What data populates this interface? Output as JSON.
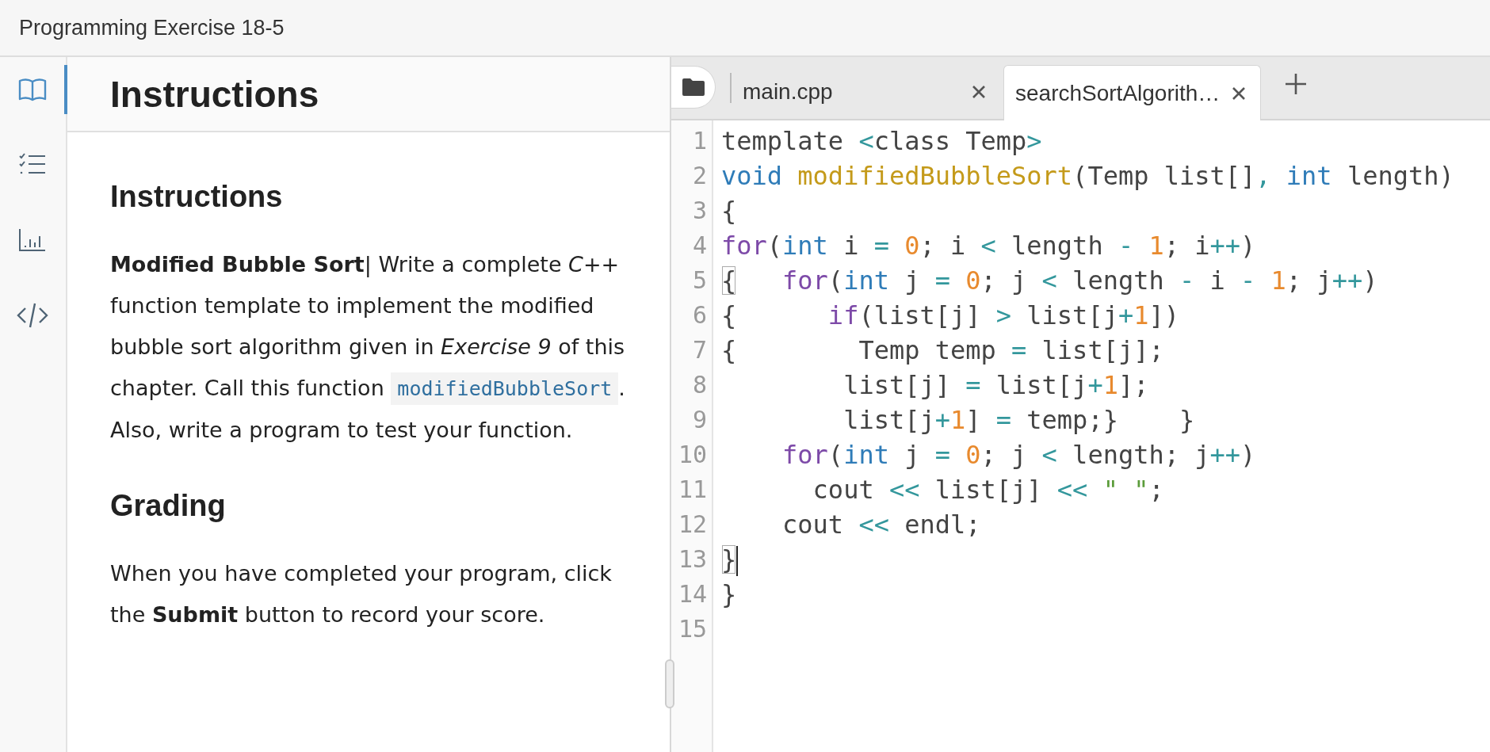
{
  "window": {
    "title": "Programming Exercise 18-5"
  },
  "rail": [
    {
      "kind": "book",
      "selected": true
    },
    {
      "kind": "checklist",
      "selected": false
    },
    {
      "kind": "chart",
      "selected": false
    },
    {
      "kind": "code",
      "selected": false
    }
  ],
  "instructions": {
    "header": "Instructions",
    "heading": "Instructions",
    "paragraph": {
      "before": "**Modified Bubble Sort**| Write a complete *C++* function template to implement the modified bubble sort algorithm given in *Exercise 9* of this chapter. Call this function",
      "code": "modifiedBubbleSort",
      "after": ". Also, write a program to test your function."
    },
    "grading_heading": "Grading",
    "grading": "When you have completed your program, click the **Submit** button to record your score."
  },
  "editor": {
    "tabs": [
      {
        "label": "main.cpp",
        "selected": false
      },
      {
        "label": "searchSortAlgorith…",
        "selected": true
      }
    ],
    "lines": [
      {
        "number": "1",
        "tokens": [
          {
            "kind": "plain",
            "text": "template "
          },
          {
            "kind": "op",
            "text": "<"
          },
          {
            "kind": "plain",
            "text": "class Temp"
          },
          {
            "kind": "op",
            "text": ">"
          }
        ]
      },
      {
        "number": "2",
        "tokens": [
          {
            "kind": "type",
            "text": "void"
          },
          {
            "kind": "fn",
            "text": " modifiedBubbleSort"
          },
          {
            "kind": "plain",
            "text": "(Temp list[]"
          },
          {
            "kind": "op",
            "text": ", "
          },
          {
            "kind": "type",
            "text": "int"
          },
          {
            "kind": "plain",
            "text": " length)"
          }
        ]
      },
      {
        "number": "3",
        "tokens": [
          {
            "kind": "plain",
            "text": "{"
          }
        ]
      },
      {
        "number": "4",
        "tokens": [
          {
            "kind": "keyword",
            "text": "for"
          },
          {
            "kind": "plain",
            "text": "("
          },
          {
            "kind": "type",
            "text": "int"
          },
          {
            "kind": "plain",
            "text": " i "
          },
          {
            "kind": "op",
            "text": "= "
          },
          {
            "kind": "num",
            "text": "0"
          },
          {
            "kind": "plain",
            "text": "; i "
          },
          {
            "kind": "op",
            "text": "<"
          },
          {
            "kind": "plain",
            "text": " length "
          },
          {
            "kind": "op",
            "text": "- "
          },
          {
            "kind": "num",
            "text": "1"
          },
          {
            "kind": "plain",
            "text": "; i"
          },
          {
            "kind": "op",
            "text": "++"
          },
          {
            "kind": "plain",
            "text": ")"
          }
        ]
      },
      {
        "number": "5",
        "tokens": [
          {
            "kind": "match",
            "text": "{"
          },
          {
            "kind": "keyword",
            "text": "   for"
          },
          {
            "kind": "plain",
            "text": "("
          },
          {
            "kind": "type",
            "text": "int"
          },
          {
            "kind": "plain",
            "text": " j "
          },
          {
            "kind": "op",
            "text": "= "
          },
          {
            "kind": "num",
            "text": "0"
          },
          {
            "kind": "plain",
            "text": "; j "
          },
          {
            "kind": "op",
            "text": "<"
          },
          {
            "kind": "plain",
            "text": " length "
          },
          {
            "kind": "op",
            "text": "-"
          },
          {
            "kind": "plain",
            "text": " i "
          },
          {
            "kind": "op",
            "text": "- "
          },
          {
            "kind": "num",
            "text": "1"
          },
          {
            "kind": "plain",
            "text": "; j"
          },
          {
            "kind": "op",
            "text": "++"
          },
          {
            "kind": "plain",
            "text": ")"
          }
        ]
      },
      {
        "number": "6",
        "tokens": [
          {
            "kind": "plain",
            "text": "{      "
          },
          {
            "kind": "keyword",
            "text": "if"
          },
          {
            "kind": "plain",
            "text": "(list[j] "
          },
          {
            "kind": "op",
            "text": ">"
          },
          {
            "kind": "plain",
            "text": " list[j"
          },
          {
            "kind": "op",
            "text": "+"
          },
          {
            "kind": "num",
            "text": "1"
          },
          {
            "kind": "plain",
            "text": "])"
          }
        ]
      },
      {
        "number": "7",
        "tokens": [
          {
            "kind": "plain",
            "text": "{        Temp temp "
          },
          {
            "kind": "op",
            "text": "="
          },
          {
            "kind": "plain",
            "text": " list[j];"
          }
        ]
      },
      {
        "number": "8",
        "tokens": [
          {
            "kind": "plain",
            "text": "        list[j] "
          },
          {
            "kind": "op",
            "text": "="
          },
          {
            "kind": "plain",
            "text": " list[j"
          },
          {
            "kind": "op",
            "text": "+"
          },
          {
            "kind": "num",
            "text": "1"
          },
          {
            "kind": "plain",
            "text": "];"
          }
        ]
      },
      {
        "number": "9",
        "tokens": [
          {
            "kind": "plain",
            "text": "        list[j"
          },
          {
            "kind": "op",
            "text": "+"
          },
          {
            "kind": "num",
            "text": "1"
          },
          {
            "kind": "plain",
            "text": "] "
          },
          {
            "kind": "op",
            "text": "="
          },
          {
            "kind": "plain",
            "text": " temp;}    }"
          }
        ]
      },
      {
        "number": "10",
        "tokens": [
          {
            "kind": "keyword",
            "text": "    for"
          },
          {
            "kind": "plain",
            "text": "("
          },
          {
            "kind": "type",
            "text": "int"
          },
          {
            "kind": "plain",
            "text": " j "
          },
          {
            "kind": "op",
            "text": "= "
          },
          {
            "kind": "num",
            "text": "0"
          },
          {
            "kind": "plain",
            "text": "; j "
          },
          {
            "kind": "op",
            "text": "<"
          },
          {
            "kind": "plain",
            "text": " length; j"
          },
          {
            "kind": "op",
            "text": "++"
          },
          {
            "kind": "plain",
            "text": ")"
          }
        ]
      },
      {
        "number": "11",
        "tokens": [
          {
            "kind": "plain",
            "text": "      cout "
          },
          {
            "kind": "op",
            "text": "<<"
          },
          {
            "kind": "plain",
            "text": " list[j] "
          },
          {
            "kind": "op",
            "text": "<< "
          },
          {
            "kind": "string",
            "text": "\" \""
          },
          {
            "kind": "plain",
            "text": ";"
          }
        ]
      },
      {
        "number": "12",
        "tokens": [
          {
            "kind": "plain",
            "text": "    cout "
          },
          {
            "kind": "op",
            "text": "<<"
          },
          {
            "kind": "plain",
            "text": " endl;"
          }
        ]
      },
      {
        "number": "13",
        "cursor": true,
        "tokens": [
          {
            "kind": "match",
            "text": "}"
          }
        ]
      },
      {
        "number": "14",
        "tokens": [
          {
            "kind": "plain",
            "text": "}"
          }
        ]
      },
      {
        "number": "15"
      }
    ]
  }
}
